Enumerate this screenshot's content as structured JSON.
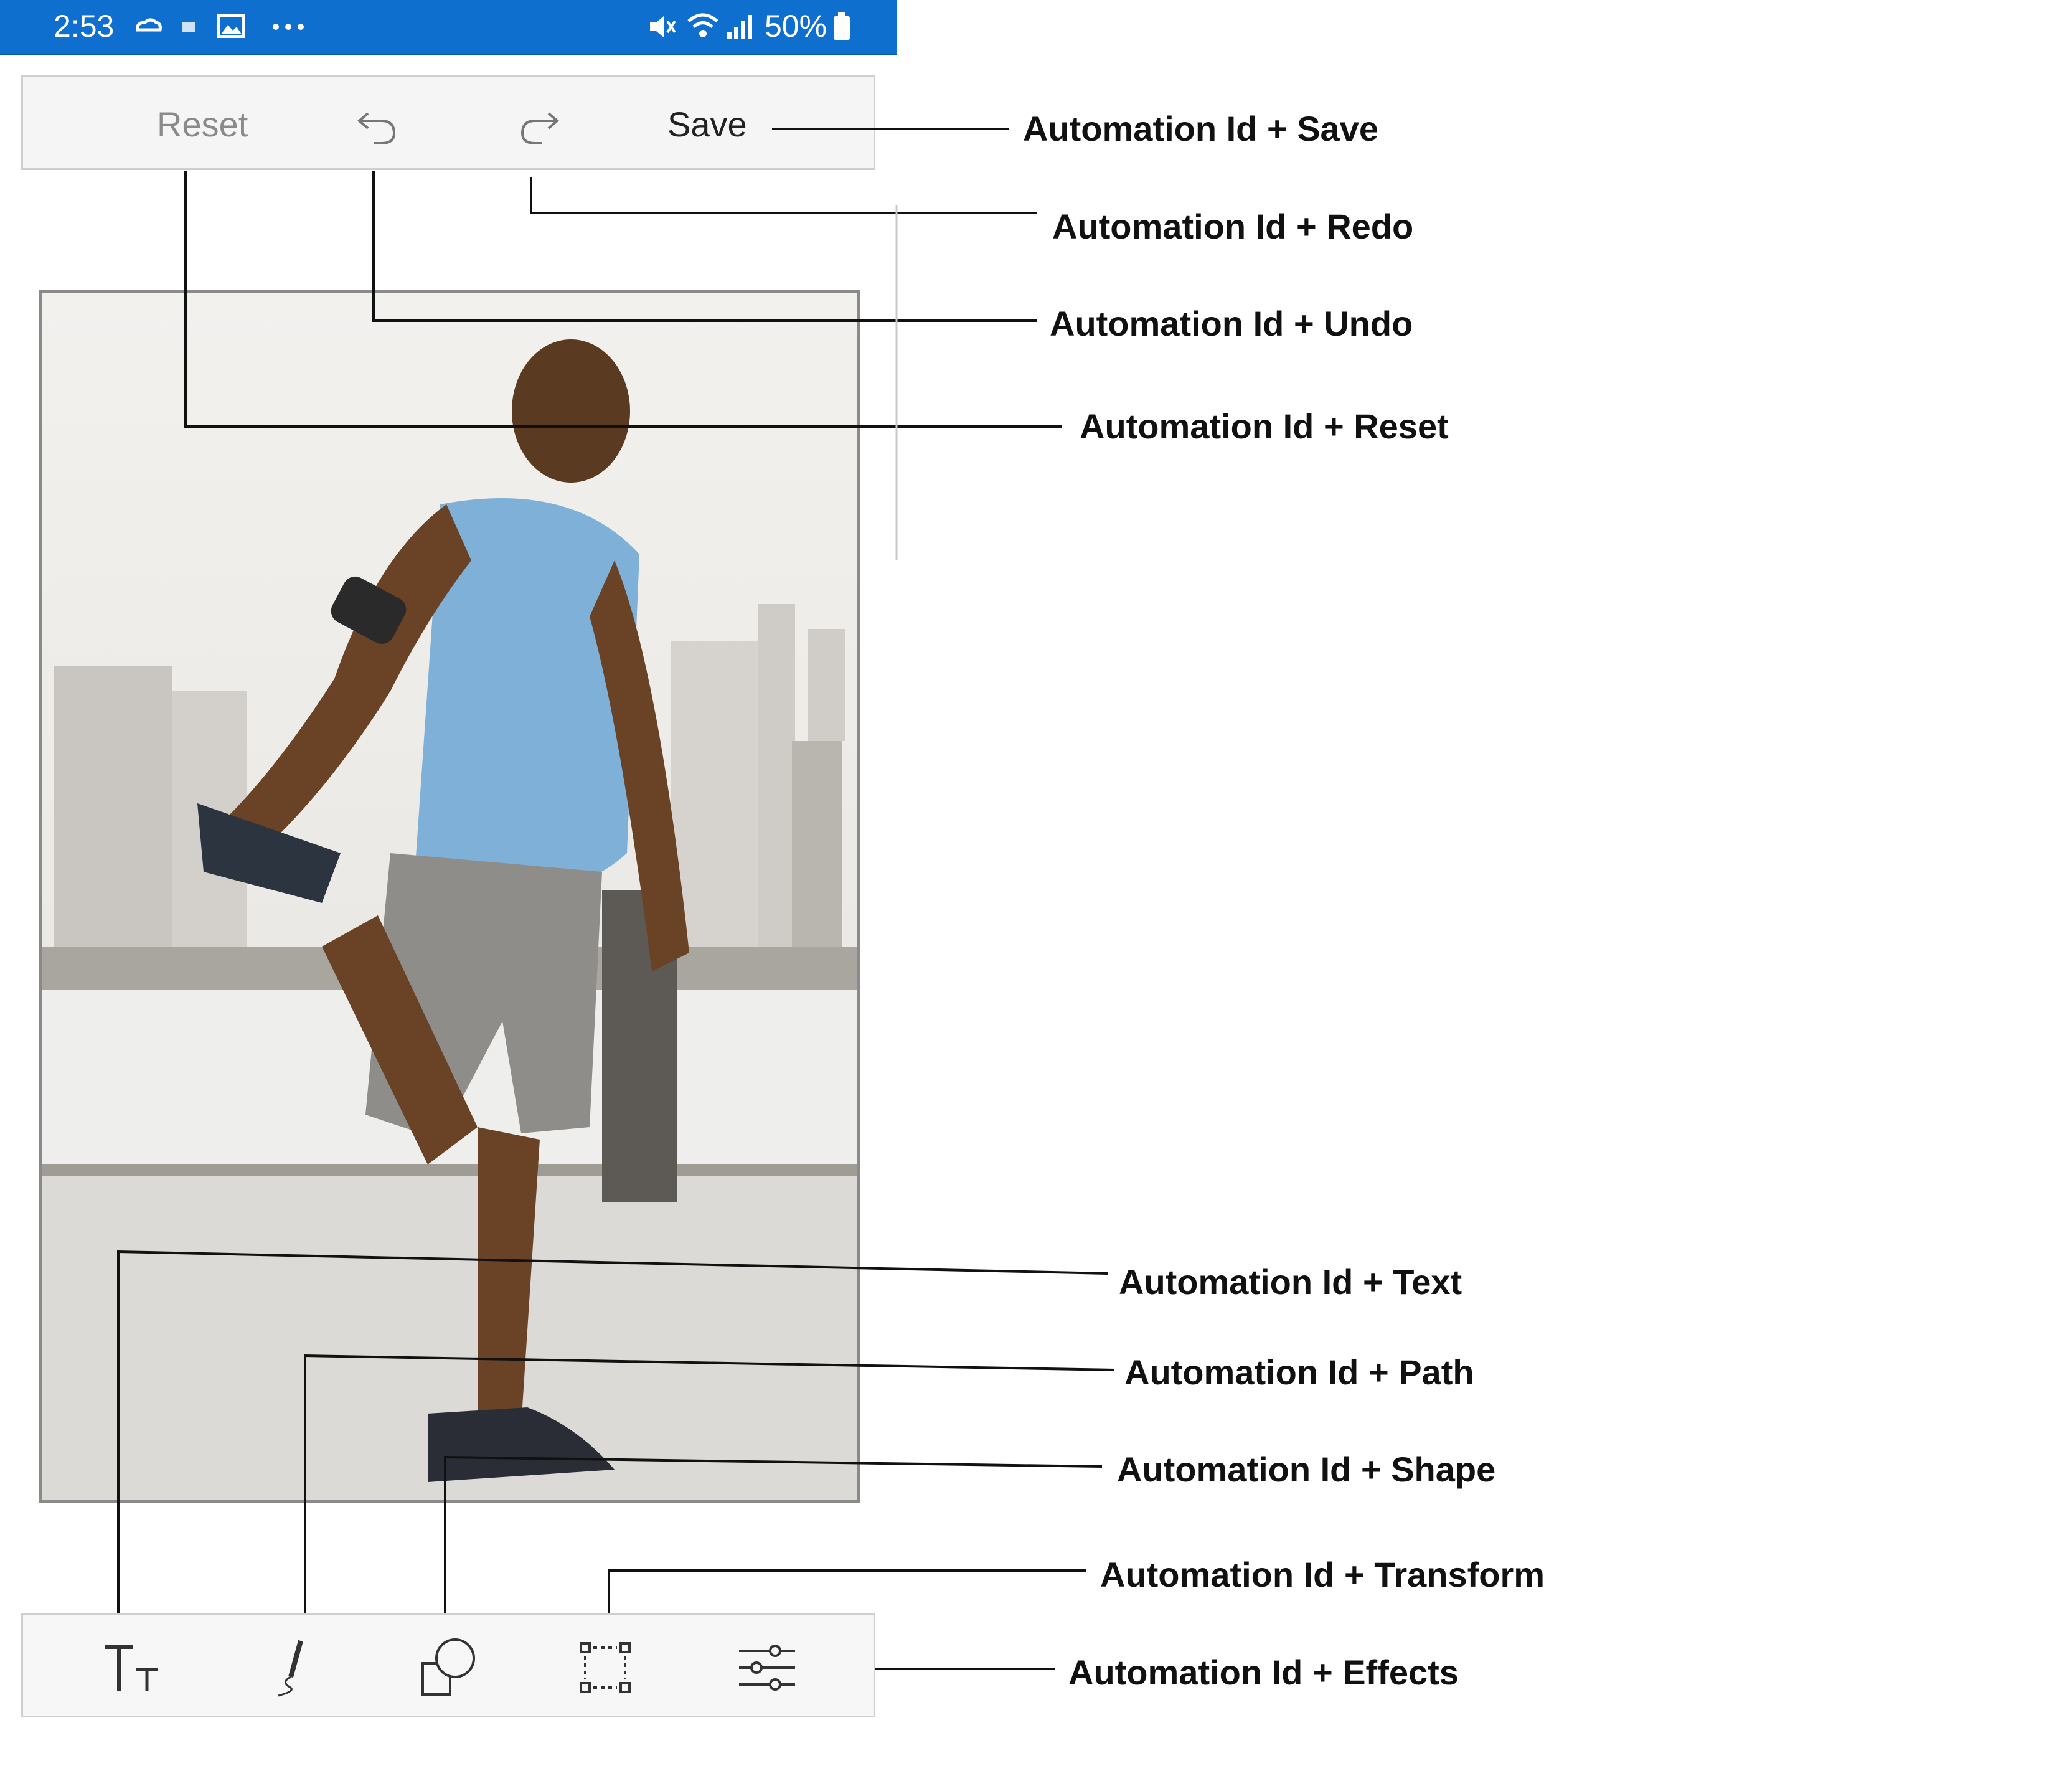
{
  "status_bar": {
    "time": "2:53",
    "icons": [
      "cloud-sync-icon",
      "dot-icon",
      "gallery-icon",
      "more-icon",
      "mute-icon",
      "wifi-icon",
      "signal-icon",
      "battery-icon"
    ],
    "battery": "50%",
    "bg_color": "#0f6fcf"
  },
  "toolbar": {
    "reset_label": "Reset",
    "undo_icon": "undo-icon",
    "redo_icon": "redo-icon",
    "save_label": "Save"
  },
  "photo": {
    "description_icon": "photo-image"
  },
  "bottom_toolbar": {
    "tools": [
      "text-icon",
      "path-pen-icon",
      "shape-icon",
      "transform-icon",
      "effects-sliders-icon"
    ]
  },
  "annotations": {
    "save": "Automation Id + Save",
    "redo": "Automation Id + Redo",
    "undo": "Automation Id + Undo",
    "reset": "Automation Id + Reset",
    "text": "Automation Id + Text",
    "path": "Automation Id + Path",
    "shape": "Automation Id + Shape",
    "transform": "Automation Id + Transform",
    "effects": "Automation Id + Effects"
  }
}
